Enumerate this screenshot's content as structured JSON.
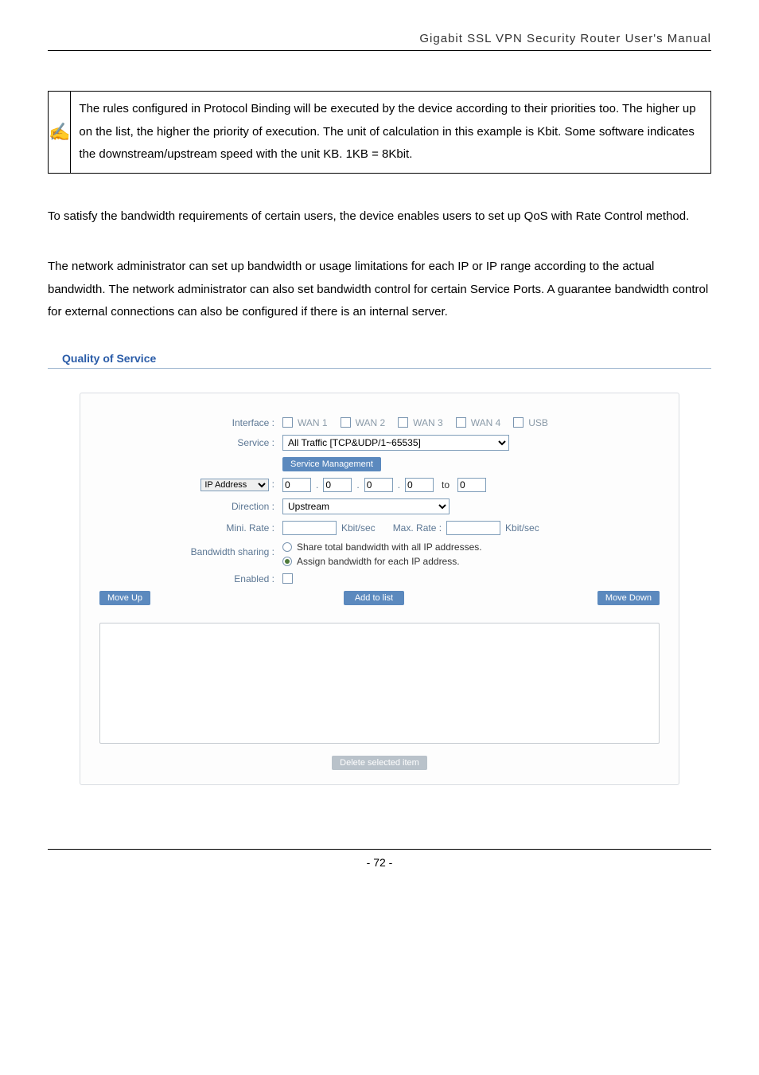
{
  "header": {
    "title": "Gigabit  SSL  VPN  Security  Router  User's  Manual"
  },
  "note": {
    "icon": "✍",
    "text": "The rules configured in Protocol Binding will be executed by the device according to their priorities too. The higher up on the list, the higher the priority of execution. The unit of calculation in this example is Kbit. Some software indicates the downstream/upstream speed with the unit KB. 1KB = 8Kbit."
  },
  "paragraphs": {
    "p1": "To satisfy the bandwidth requirements of certain users, the device enables users to set up QoS with Rate Control method.",
    "p2": "The network administrator can set up bandwidth or usage limitations for each IP or IP range according to the actual bandwidth. The network administrator can also set bandwidth control for certain Service Ports. A guarantee bandwidth control for external connections can also be configured if there is an internal server."
  },
  "section_title": "Quality of Service",
  "form": {
    "labels": {
      "interface": "Interface :",
      "service": "Service :",
      "ip_address": "IP Address",
      "direction": "Direction :",
      "mini_rate": "Mini. Rate :",
      "bandwidth_sharing": "Bandwidth sharing :",
      "enabled": "Enabled  :"
    },
    "interface_options": {
      "wan1": "WAN 1",
      "wan2": "WAN 2",
      "wan3": "WAN 3",
      "wan4": "WAN 4",
      "usb": "USB"
    },
    "service_value": "All Traffic [TCP&UDP/1~65535]",
    "service_mgmt_btn": "Service Management",
    "ip": {
      "o1": "0",
      "o2": "0",
      "o3": "0",
      "o4": "0",
      "to": "to",
      "o5": "0"
    },
    "direction_value": "Upstream",
    "rate": {
      "min": "",
      "min_unit": "Kbit/sec",
      "max_label": "Max. Rate :",
      "max": "",
      "max_unit": "Kbit/sec"
    },
    "sharing": {
      "opt1": "Share total bandwidth with all IP addresses.",
      "opt2": "Assign bandwidth for each IP address."
    },
    "buttons": {
      "move_up": "Move Up",
      "add": "Add to list",
      "move_down": "Move Down",
      "delete": "Delete selected item"
    }
  },
  "footer": {
    "page": "- 72 -"
  }
}
